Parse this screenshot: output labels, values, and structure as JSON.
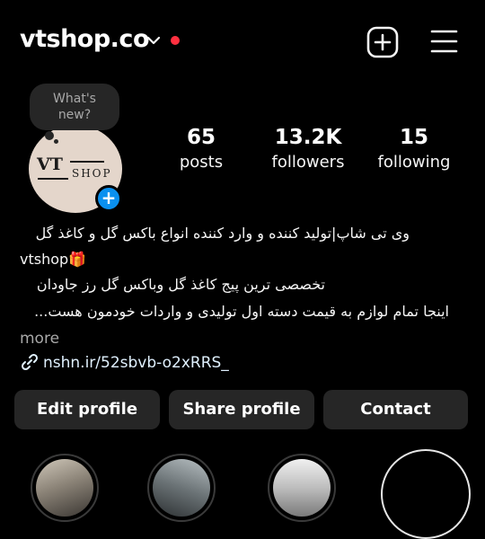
{
  "header": {
    "username": "vtshop.co",
    "icons": {
      "chevron": "chevron-down-icon",
      "notification": "red-dot",
      "create": "plus-square-icon",
      "menu": "hamburger-menu-icon"
    },
    "notification_color": "#ff3040"
  },
  "note": {
    "text_line1": "What's",
    "text_line2": "new?"
  },
  "avatar": {
    "logo_vt": "VT",
    "logo_shop": "SHOP"
  },
  "stats": {
    "posts": {
      "count": "65",
      "label": "posts"
    },
    "followers": {
      "count": "13.2K",
      "label": "followers"
    },
    "following": {
      "count": "15",
      "label": "following"
    }
  },
  "bio": {
    "line1": "وی تی شاپ|تولید کننده و وارد کننده انواع باکس گل و کاغذ گل",
    "line2": "vtshop🎁",
    "line3": "تخصصی ترین پیج کاغذ گل وباکس گل رز جاودان",
    "line4": "اینجا تمام لوازم به قیمت دسته اول تولیدی و واردات خودمون هست...",
    "more": "more",
    "link": "nshn.ir/52sbvb-o2xRRS_"
  },
  "buttons": {
    "edit": "Edit profile",
    "share": "Share profile",
    "contact": "Contact"
  },
  "colors": {
    "background": "#000000",
    "button_bg": "#262626",
    "accent_blue": "#0a90ef"
  }
}
